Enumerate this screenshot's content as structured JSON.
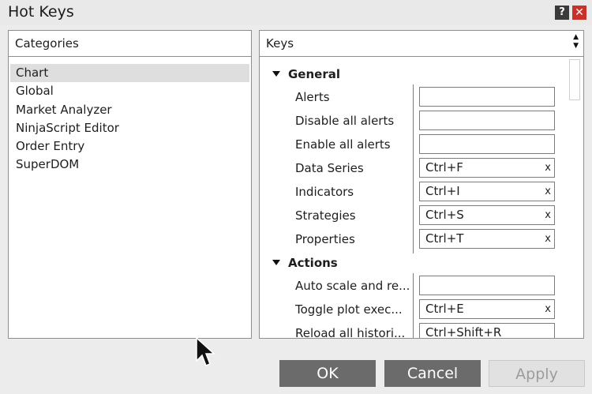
{
  "window": {
    "title": "Hot Keys",
    "help_label": "?",
    "close_label": "✕"
  },
  "categories": {
    "header": "Categories",
    "items": [
      {
        "label": "Chart",
        "selected": true
      },
      {
        "label": "Global"
      },
      {
        "label": "Market Analyzer"
      },
      {
        "label": "NinjaScript Editor"
      },
      {
        "label": "Order Entry"
      },
      {
        "label": "SuperDOM"
      }
    ]
  },
  "keys": {
    "header": "Keys",
    "sort_up": "▲",
    "sort_down": "▼",
    "clear_label": "x",
    "groups": [
      {
        "name": "General",
        "rows": [
          {
            "label": "Alerts",
            "value": ""
          },
          {
            "label": "Disable all alerts",
            "value": ""
          },
          {
            "label": "Enable all alerts",
            "value": ""
          },
          {
            "label": "Data Series",
            "value": "Ctrl+F"
          },
          {
            "label": "Indicators",
            "value": "Ctrl+I"
          },
          {
            "label": "Strategies",
            "value": "Ctrl+S"
          },
          {
            "label": "Properties",
            "value": "Ctrl+T"
          }
        ]
      },
      {
        "name": "Actions",
        "rows": [
          {
            "label": "Auto scale and re...",
            "value": ""
          },
          {
            "label": "Toggle plot exec...",
            "value": "Ctrl+E"
          },
          {
            "label": "Reload all histori...",
            "value": "Ctrl+Shift+R"
          }
        ]
      }
    ]
  },
  "buttons": {
    "ok": "OK",
    "cancel": "Cancel",
    "apply": "Apply"
  }
}
